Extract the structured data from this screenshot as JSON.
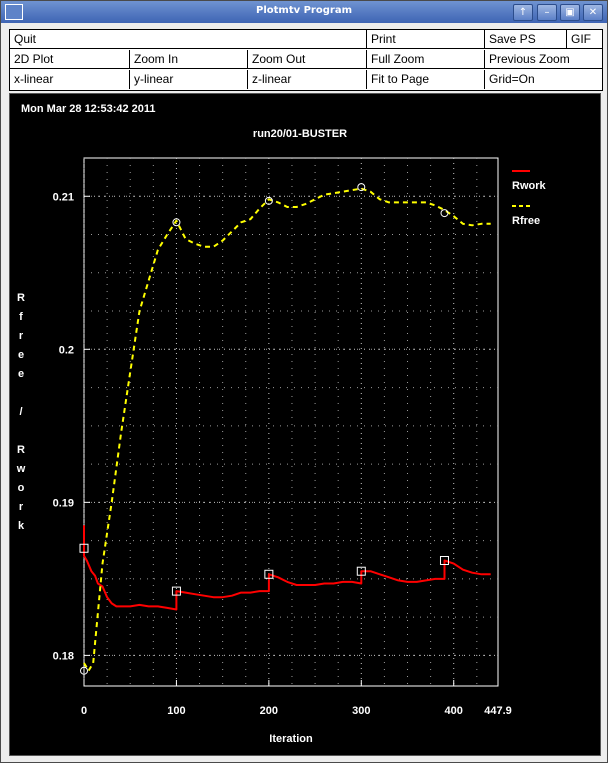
{
  "window": {
    "title": "Plotmtv Program",
    "buttons": {
      "up": "↑",
      "minimize": "–",
      "restore": "▣",
      "close": "✕"
    }
  },
  "menu": {
    "quit": "Quit",
    "print": "Print",
    "save_ps": "Save PS",
    "gif": "GIF",
    "plot_2d": "2D Plot",
    "zoom_in": "Zoom In",
    "zoom_out": "Zoom Out",
    "full_zoom": "Full Zoom",
    "previous_zoom": "Previous Zoom",
    "x_linear": "x-linear",
    "y_linear": "y-linear",
    "z_linear": "z-linear",
    "fit_to_page": "Fit to Page",
    "grid_on": "Grid=On"
  },
  "plot": {
    "timestamp": "Mon Mar 28 12:53:42 2011",
    "title": "run20/01-BUSTER",
    "xlabel": "Iteration",
    "ylabel_chars": [
      "R",
      "f",
      "r",
      "e",
      "e",
      "",
      "/",
      "",
      "R",
      "w",
      "o",
      "r",
      "k"
    ]
  },
  "colors": {
    "rwork": "#ff0000",
    "rfree": "#ffff00",
    "background": "#000000",
    "grid": "#c8c8c8",
    "axis_text": "#ffffff"
  },
  "chart_data": {
    "type": "line",
    "title": "run20/01-BUSTER",
    "xlabel": "Iteration",
    "ylabel": "Rfree / Rwork",
    "xlim": [
      0,
      447.9
    ],
    "ylim": [
      0.178,
      0.2125
    ],
    "x_ticks": [
      0,
      100,
      200,
      300,
      400
    ],
    "x_tick_labels": [
      "0",
      "100",
      "200",
      "300",
      "400",
      "447.9"
    ],
    "y_ticks": [
      0.18,
      0.19,
      0.2,
      0.21
    ],
    "y_tick_labels": [
      "0.18",
      "0.19",
      "0.2",
      "0.21"
    ],
    "grid": true,
    "legend_position": "top-right",
    "series": [
      {
        "name": "Rwork",
        "style": "solid",
        "x": [
          0,
          0,
          3,
          8,
          12,
          15,
          20,
          25,
          30,
          35,
          40,
          50,
          60,
          70,
          80,
          90,
          100,
          100,
          110,
          120,
          130,
          140,
          150,
          160,
          170,
          180,
          190,
          200,
          200,
          210,
          220,
          230,
          240,
          250,
          260,
          270,
          280,
          290,
          300,
          300,
          310,
          320,
          330,
          340,
          350,
          360,
          370,
          380,
          390,
          390,
          400,
          410,
          420,
          430,
          440
        ],
        "y": [
          0.1885,
          0.1865,
          0.1862,
          0.1855,
          0.1852,
          0.1847,
          0.1845,
          0.1838,
          0.1834,
          0.1832,
          0.1832,
          0.1832,
          0.1833,
          0.1832,
          0.1832,
          0.1831,
          0.183,
          0.1842,
          0.1841,
          0.184,
          0.1839,
          0.1838,
          0.1838,
          0.1839,
          0.1841,
          0.1841,
          0.1842,
          0.1842,
          0.1853,
          0.1851,
          0.1848,
          0.1846,
          0.1846,
          0.1846,
          0.1847,
          0.1847,
          0.1848,
          0.1848,
          0.1847,
          0.1855,
          0.1855,
          0.1853,
          0.1851,
          0.1849,
          0.1848,
          0.1848,
          0.1849,
          0.185,
          0.185,
          0.1862,
          0.186,
          0.1856,
          0.1854,
          0.1853,
          0.1853
        ]
      },
      {
        "name": "Rfree",
        "style": "dashed",
        "x": [
          0,
          5,
          10,
          20,
          30,
          40,
          50,
          60,
          70,
          80,
          90,
          100,
          110,
          120,
          130,
          140,
          150,
          160,
          170,
          180,
          190,
          200,
          210,
          220,
          230,
          240,
          250,
          260,
          270,
          280,
          290,
          300,
          310,
          320,
          330,
          340,
          350,
          360,
          370,
          380,
          390,
          400,
          410,
          420,
          430,
          440
        ],
        "y": [
          0.1795,
          0.179,
          0.1795,
          0.186,
          0.19,
          0.1945,
          0.1985,
          0.2025,
          0.2045,
          0.2065,
          0.2075,
          0.2084,
          0.2072,
          0.2069,
          0.2067,
          0.2067,
          0.2071,
          0.2077,
          0.2083,
          0.2085,
          0.2092,
          0.2098,
          0.2096,
          0.2093,
          0.2093,
          0.2095,
          0.2098,
          0.2101,
          0.2102,
          0.2103,
          0.2104,
          0.2105,
          0.2103,
          0.2098,
          0.2096,
          0.2096,
          0.2096,
          0.2096,
          0.2096,
          0.2094,
          0.2091,
          0.2087,
          0.2082,
          0.2081,
          0.2082,
          0.2082
        ]
      }
    ],
    "markers": {
      "Rwork": [
        [
          0,
          0.187
        ],
        [
          100,
          0.1842
        ],
        [
          200,
          0.1853
        ],
        [
          300,
          0.1855
        ],
        [
          390,
          0.1862
        ]
      ],
      "Rfree": [
        [
          0,
          0.179
        ],
        [
          100,
          0.2083
        ],
        [
          200,
          0.2097
        ],
        [
          300,
          0.2106
        ],
        [
          390,
          0.2089
        ]
      ]
    }
  }
}
